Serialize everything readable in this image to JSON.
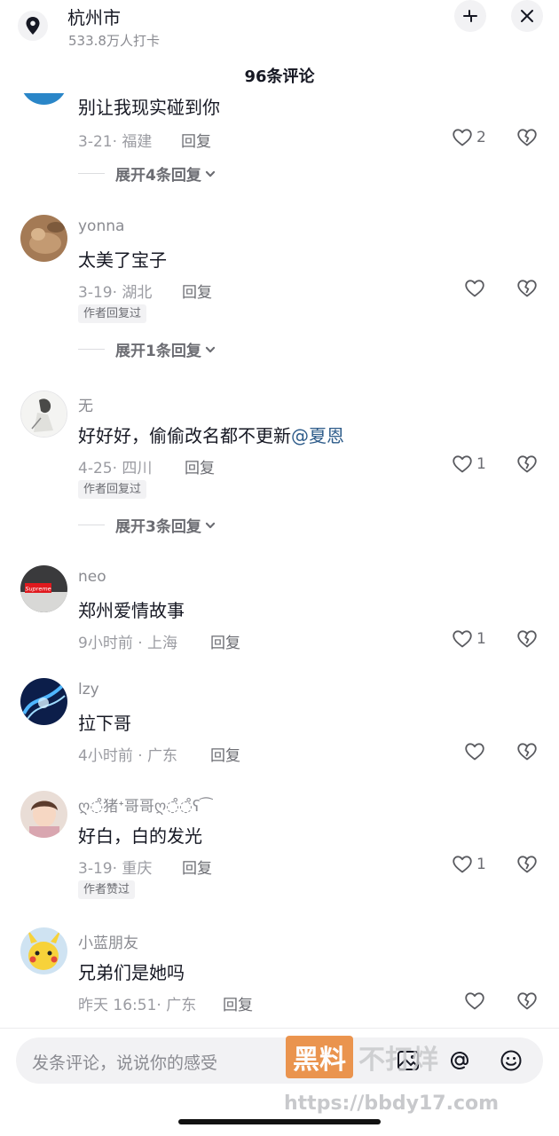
{
  "header": {
    "city": "杭州市",
    "checkin_count": "533.8万人打卡",
    "comments_title": "96条评论"
  },
  "comments": [
    {
      "text": "别让我现实碰到你",
      "date_region": "3-21· 福建",
      "reply_label": "回复",
      "likes": "2",
      "expand_label": "展开4条回复"
    },
    {
      "username": "yonna",
      "text": "太美了宝子",
      "date_region": "3-19· 湖北",
      "reply_label": "回复",
      "badge": "作者回复过",
      "expand_label": "展开1条回复"
    },
    {
      "username": "无",
      "text": "好好好，偷偷改名都不更新",
      "mention": "@夏恩",
      "date_region": "4-25· 四川",
      "reply_label": "回复",
      "likes": "1",
      "badge": "作者回复过",
      "expand_label": "展开3条回复"
    },
    {
      "username": "neo",
      "text": "郑州爱情故事",
      "date_region": "9小时前 · 上海",
      "reply_label": "回复",
      "likes": "1",
      "avatar_text": "Supreme"
    },
    {
      "username": "lzy",
      "text": "拉下哥",
      "date_region": "4小时前 · 广东",
      "reply_label": "回复"
    },
    {
      "username": "ღ◌̊猪ᐩ哥哥ღ◌̊◌̊ʕ⁀",
      "text": "好白，白的发光",
      "date_region": "3-19· 重庆",
      "reply_label": "回复",
      "likes": "1",
      "badge": "作者赞过"
    },
    {
      "username": "小蓝朋友",
      "text": "兄弟们是她吗",
      "date_region": "昨天 16:51· 广东",
      "reply_label": "回复"
    }
  ],
  "bottom": {
    "placeholder": "发条评论，说说你的感受",
    "watermark_a": "黑料",
    "watermark_b": "不打烊",
    "watermark_url": "https://bbdy17.com"
  },
  "icons": [
    "location-pin-icon",
    "collapse-icon",
    "close-icon",
    "heart-icon",
    "broken-heart-icon",
    "chevron-down-icon",
    "image-icon",
    "at-icon",
    "emoji-icon"
  ]
}
